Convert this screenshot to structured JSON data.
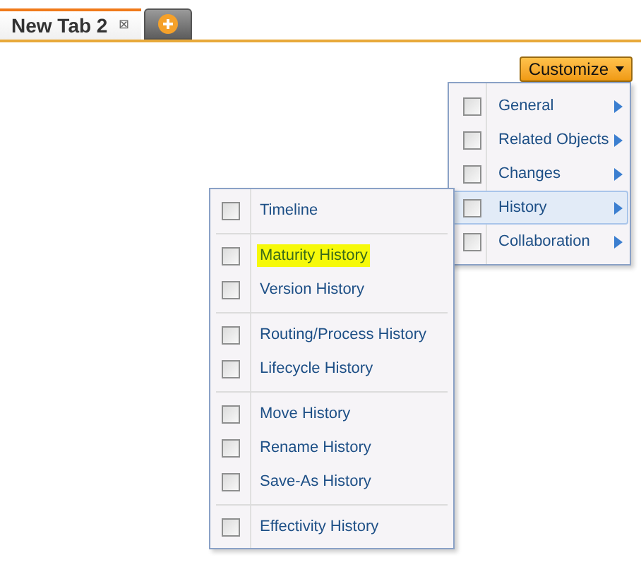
{
  "tabs": [
    {
      "label": "New Tab 2",
      "close": "⊠",
      "selected": true
    }
  ],
  "customize_button": {
    "label": "Customize"
  },
  "menu": {
    "items": [
      {
        "label": "General",
        "checked": false,
        "selected": false
      },
      {
        "label": "Related Objects",
        "checked": false,
        "selected": false
      },
      {
        "label": "Changes",
        "checked": false,
        "selected": false
      },
      {
        "label": "History",
        "checked": false,
        "selected": true
      },
      {
        "label": "Collaboration",
        "checked": false,
        "selected": false
      }
    ]
  },
  "submenu": {
    "groups": [
      [
        {
          "label": "Timeline",
          "checked": false,
          "highlighted": false
        }
      ],
      [
        {
          "label": "Maturity History",
          "checked": false,
          "highlighted": true
        },
        {
          "label": "Version History",
          "checked": false,
          "highlighted": false
        }
      ],
      [
        {
          "label": "Routing/Process History",
          "checked": false,
          "highlighted": false
        },
        {
          "label": "Lifecycle History",
          "checked": false,
          "highlighted": false
        }
      ],
      [
        {
          "label": "Move History",
          "checked": false,
          "highlighted": false
        },
        {
          "label": "Rename History",
          "checked": false,
          "highlighted": false
        },
        {
          "label": "Save-As History",
          "checked": false,
          "highlighted": false
        }
      ],
      [
        {
          "label": "Effectivity History",
          "checked": false,
          "highlighted": false
        }
      ]
    ]
  }
}
